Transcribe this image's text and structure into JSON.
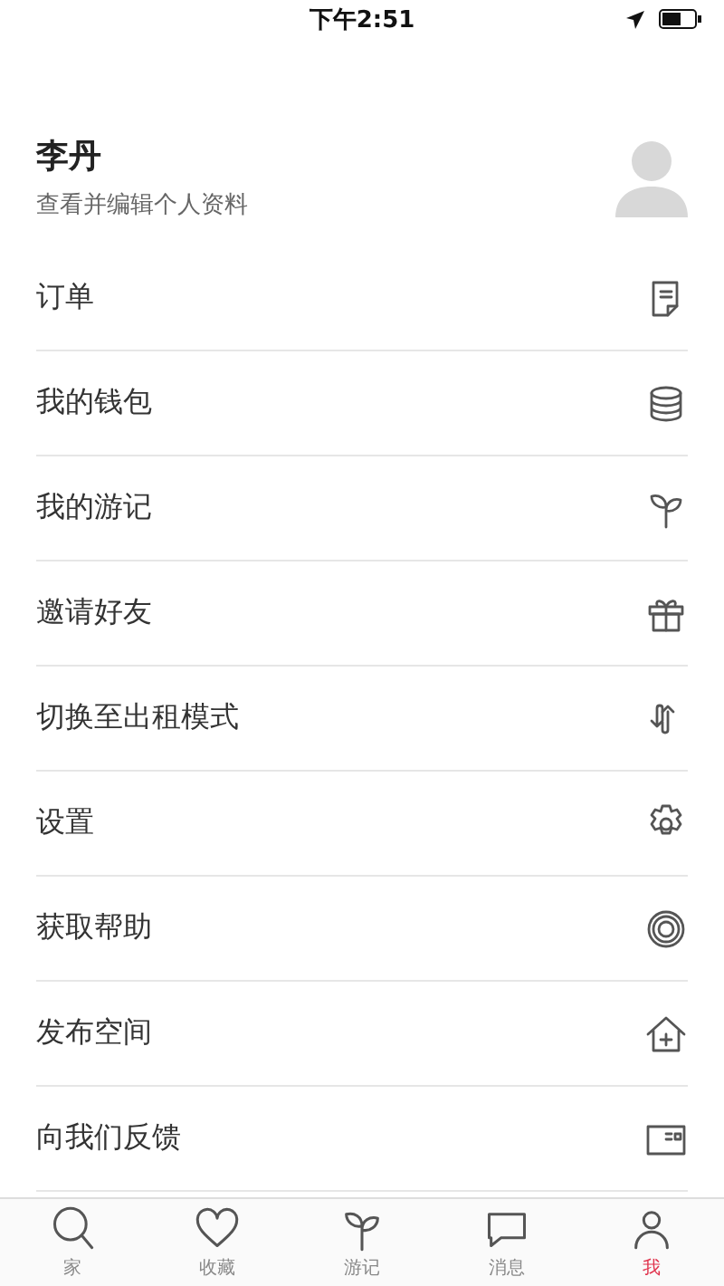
{
  "status_bar": {
    "time": "下午2:51"
  },
  "profile": {
    "name": "李丹",
    "subtitle": "查看并编辑个人资料"
  },
  "menu": [
    {
      "label": "订单"
    },
    {
      "label": "我的钱包"
    },
    {
      "label": "我的游记"
    },
    {
      "label": "邀请好友"
    },
    {
      "label": "切换至出租模式"
    },
    {
      "label": "设置"
    },
    {
      "label": "获取帮助"
    },
    {
      "label": "发布空间"
    },
    {
      "label": "向我们反馈"
    }
  ],
  "tabs": [
    {
      "label": "家",
      "selected": false
    },
    {
      "label": "收藏",
      "selected": false
    },
    {
      "label": "游记",
      "selected": false
    },
    {
      "label": "消息",
      "selected": false
    },
    {
      "label": "我",
      "selected": true
    }
  ]
}
